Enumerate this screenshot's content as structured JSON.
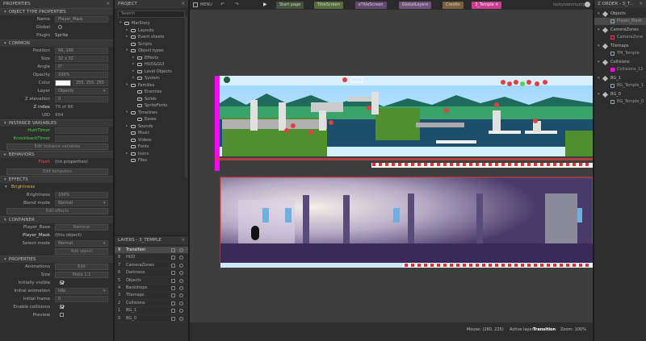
{
  "properties": {
    "title": "PROPERTIES",
    "sections": {
      "object_props": "OBJECT TYPE PROPERTIES",
      "common": "COMMON",
      "instance_vars": "INSTANCE VARIABLES",
      "behaviors": "BEHAVIORS",
      "effects": "EFFECTS",
      "container": "CONTAINER",
      "props2": "PROPERTIES"
    },
    "name_label": "Name",
    "name_value": "Player_Mask",
    "global_label": "Global",
    "plugin_label": "Plugin",
    "plugin_value": "Sprite",
    "position_label": "Position",
    "position_value": "66, 166",
    "size_label": "Size",
    "size_value": "32 x 32",
    "angle_label": "Angle",
    "angle_value": "0°",
    "opacity_label": "Opacity",
    "opacity_value": "100%",
    "color_label": "Color",
    "color_value": "255, 255, 255",
    "layer_label": "Layer",
    "layer_value": "Objects",
    "zelev_label": "Z elevation",
    "zelev_value": "0",
    "zindex_label": "Z index",
    "zindex_value": "79 of 86",
    "uid_label": "UID",
    "uid_value": "994",
    "var1": "HurtTimer",
    "var2": "KnockbackTimer",
    "edit_vars": "Edit instance variables",
    "behavior_name": "Flash",
    "behavior_props": "(no properties)",
    "edit_behaviors": "Edit behaviors",
    "effect_name": "Brightness",
    "brightness_label": "Brightness",
    "brightness_value": "100%",
    "blend_label": "Blend mode",
    "blend_value": "Normal",
    "edit_effects": "Edit effects",
    "cont_item1": "Player_Base",
    "cont_btn1": "Remove",
    "cont_item2": "Player_Mask",
    "cont_this": "(this object)",
    "select_mode_label": "Select mode",
    "select_mode_value": "Normal",
    "add_object": "Add object",
    "anim_label": "Animations",
    "anim_btn": "Edit",
    "size2_label": "Size",
    "size2_btn": "Make 1:1",
    "init_vis_label": "Initially visible",
    "init_anim_label": "Initial animation",
    "init_anim_value": "Idle",
    "init_frame_label": "Initial frame",
    "init_frame_value": "0",
    "enable_coll_label": "Enable collisions",
    "preview_label": "Preview"
  },
  "project": {
    "title": "PROJECT",
    "search_placeholder": "Search",
    "tree": [
      {
        "label": "MarStory",
        "level": 0,
        "arrow": "▾"
      },
      {
        "label": "Layouts",
        "level": 1,
        "arrow": "▸"
      },
      {
        "label": "Event sheets",
        "level": 1,
        "arrow": "▸"
      },
      {
        "label": "Scripts",
        "level": 1,
        "arrow": ""
      },
      {
        "label": "Object types",
        "level": 1,
        "arrow": "▾"
      },
      {
        "label": "Effects",
        "level": 2,
        "arrow": "▸"
      },
      {
        "label": "HUD&GUI",
        "level": 2,
        "arrow": "▸"
      },
      {
        "label": "Level Objects",
        "level": 2,
        "arrow": "▸"
      },
      {
        "label": "System",
        "level": 2,
        "arrow": "▸"
      },
      {
        "label": "Families",
        "level": 1,
        "arrow": "▾"
      },
      {
        "label": "Enemies",
        "level": 2,
        "arrow": ""
      },
      {
        "label": "Solids",
        "level": 2,
        "arrow": ""
      },
      {
        "label": "SpriteFonts",
        "level": 2,
        "arrow": ""
      },
      {
        "label": "Timelines",
        "level": 1,
        "arrow": "▾"
      },
      {
        "label": "Eases",
        "level": 2,
        "arrow": ""
      },
      {
        "label": "Sounds",
        "level": 1,
        "arrow": "▸"
      },
      {
        "label": "Music",
        "level": 1,
        "arrow": ""
      },
      {
        "label": "Videos",
        "level": 1,
        "arrow": ""
      },
      {
        "label": "Fonts",
        "level": 1,
        "arrow": ""
      },
      {
        "label": "Icons",
        "level": 1,
        "arrow": "▸"
      },
      {
        "label": "Files",
        "level": 1,
        "arrow": ""
      }
    ]
  },
  "layers": {
    "title": "LAYERS - 3_TEMPLE",
    "items": [
      {
        "num": "9",
        "name": "Transition",
        "selected": true
      },
      {
        "num": "8",
        "name": "HUD",
        "selected": false
      },
      {
        "num": "7",
        "name": "CameraZones",
        "selected": false
      },
      {
        "num": "6",
        "name": "Darkness",
        "selected": false
      },
      {
        "num": "5",
        "name": "Objects",
        "selected": false
      },
      {
        "num": "4",
        "name": "Backdrops",
        "selected": false
      },
      {
        "num": "3",
        "name": "Tilemaps",
        "selected": false
      },
      {
        "num": "2",
        "name": "Collisions",
        "selected": false
      },
      {
        "num": "1",
        "name": "BG_1",
        "selected": false
      },
      {
        "num": "0",
        "name": "BG_0",
        "selected": false
      }
    ]
  },
  "toolbar": {
    "menu": "MENU",
    "tabs": [
      {
        "label": "Start page",
        "color": "#4d5a3e",
        "active": false
      },
      {
        "label": "TitleScreen",
        "color": "#5f7a3e",
        "active": false
      },
      {
        "label": "eTitleScreen",
        "color": "#6e4e7c",
        "active": false
      },
      {
        "label": "GlobalLayers",
        "color": "#7e5a8a",
        "active": false
      },
      {
        "label": "Credits",
        "color": "#8a6a3e",
        "active": false
      },
      {
        "label": "3_Temple",
        "color": "#c93f8f",
        "active": true
      }
    ],
    "user": "lackyownmuzzy"
  },
  "status": {
    "mouse": "Mouse: (260, 225)",
    "active_layer_label": "Active layer:",
    "active_layer": "Transition",
    "zoom": "Zoom: 100%"
  },
  "zorder": {
    "title": "Z ORDER - 3_T...",
    "groups": [
      {
        "layer": "Objects",
        "items": [
          "Player_Mask"
        ]
      },
      {
        "layer": "CameraZones",
        "items": [
          "CameraZone"
        ]
      },
      {
        "layer": "Tilemaps",
        "items": [
          "TM_Temple"
        ]
      },
      {
        "layer": "Collisions",
        "items": [
          "Collisions_12"
        ]
      },
      {
        "layer": "BG_1",
        "items": [
          "BG_Temple_1"
        ]
      },
      {
        "layer": "BG_0",
        "items": [
          "BG_Temple_0"
        ]
      }
    ]
  },
  "colors": {
    "accent": "#c93f8f",
    "magenta": "#ff00ff",
    "red_outline": "#e04040",
    "green_var": "#4fd64f"
  }
}
